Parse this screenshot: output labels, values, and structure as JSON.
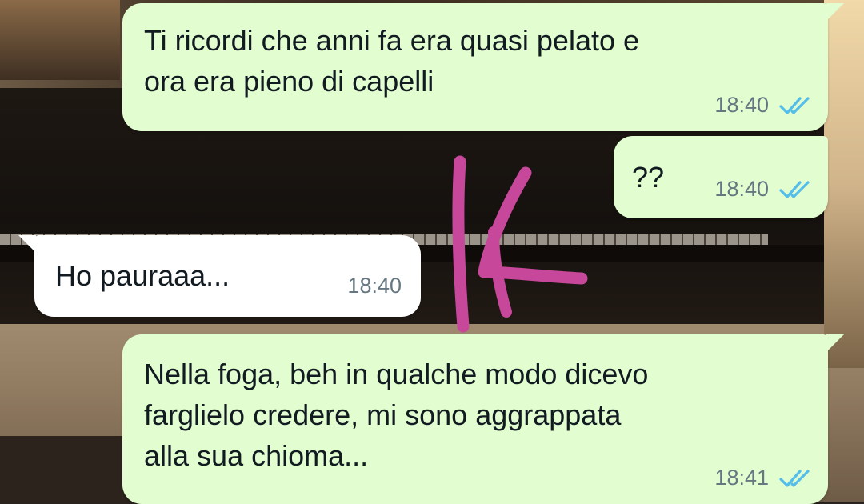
{
  "chat": {
    "messages": [
      {
        "direction": "outgoing",
        "text": "Ti ricordi che anni fa era quasi pelato e\nora era pieno di capelli",
        "time": "18:40",
        "status_icon": "double-check-read-icon"
      },
      {
        "direction": "outgoing",
        "text": "??",
        "time": "18:40",
        "status_icon": "double-check-read-icon"
      },
      {
        "direction": "incoming",
        "text": "Ho pauraaa...",
        "time": "18:40"
      },
      {
        "direction": "outgoing",
        "text": "Nella foga, beh in qualche modo dicevo\nfarglielo credere, mi sono aggrappata\nalla sua chioma...",
        "time": "18:41",
        "status_icon": "double-check-read-icon"
      }
    ]
  },
  "annotation": {
    "color": "#c7479a",
    "icon": "scribble-annotation"
  },
  "colors": {
    "outgoing_bubble": "#e2fdcf",
    "incoming_bubble": "#ffffff",
    "read_check": "#53bdeb",
    "time_text": "#667781"
  }
}
